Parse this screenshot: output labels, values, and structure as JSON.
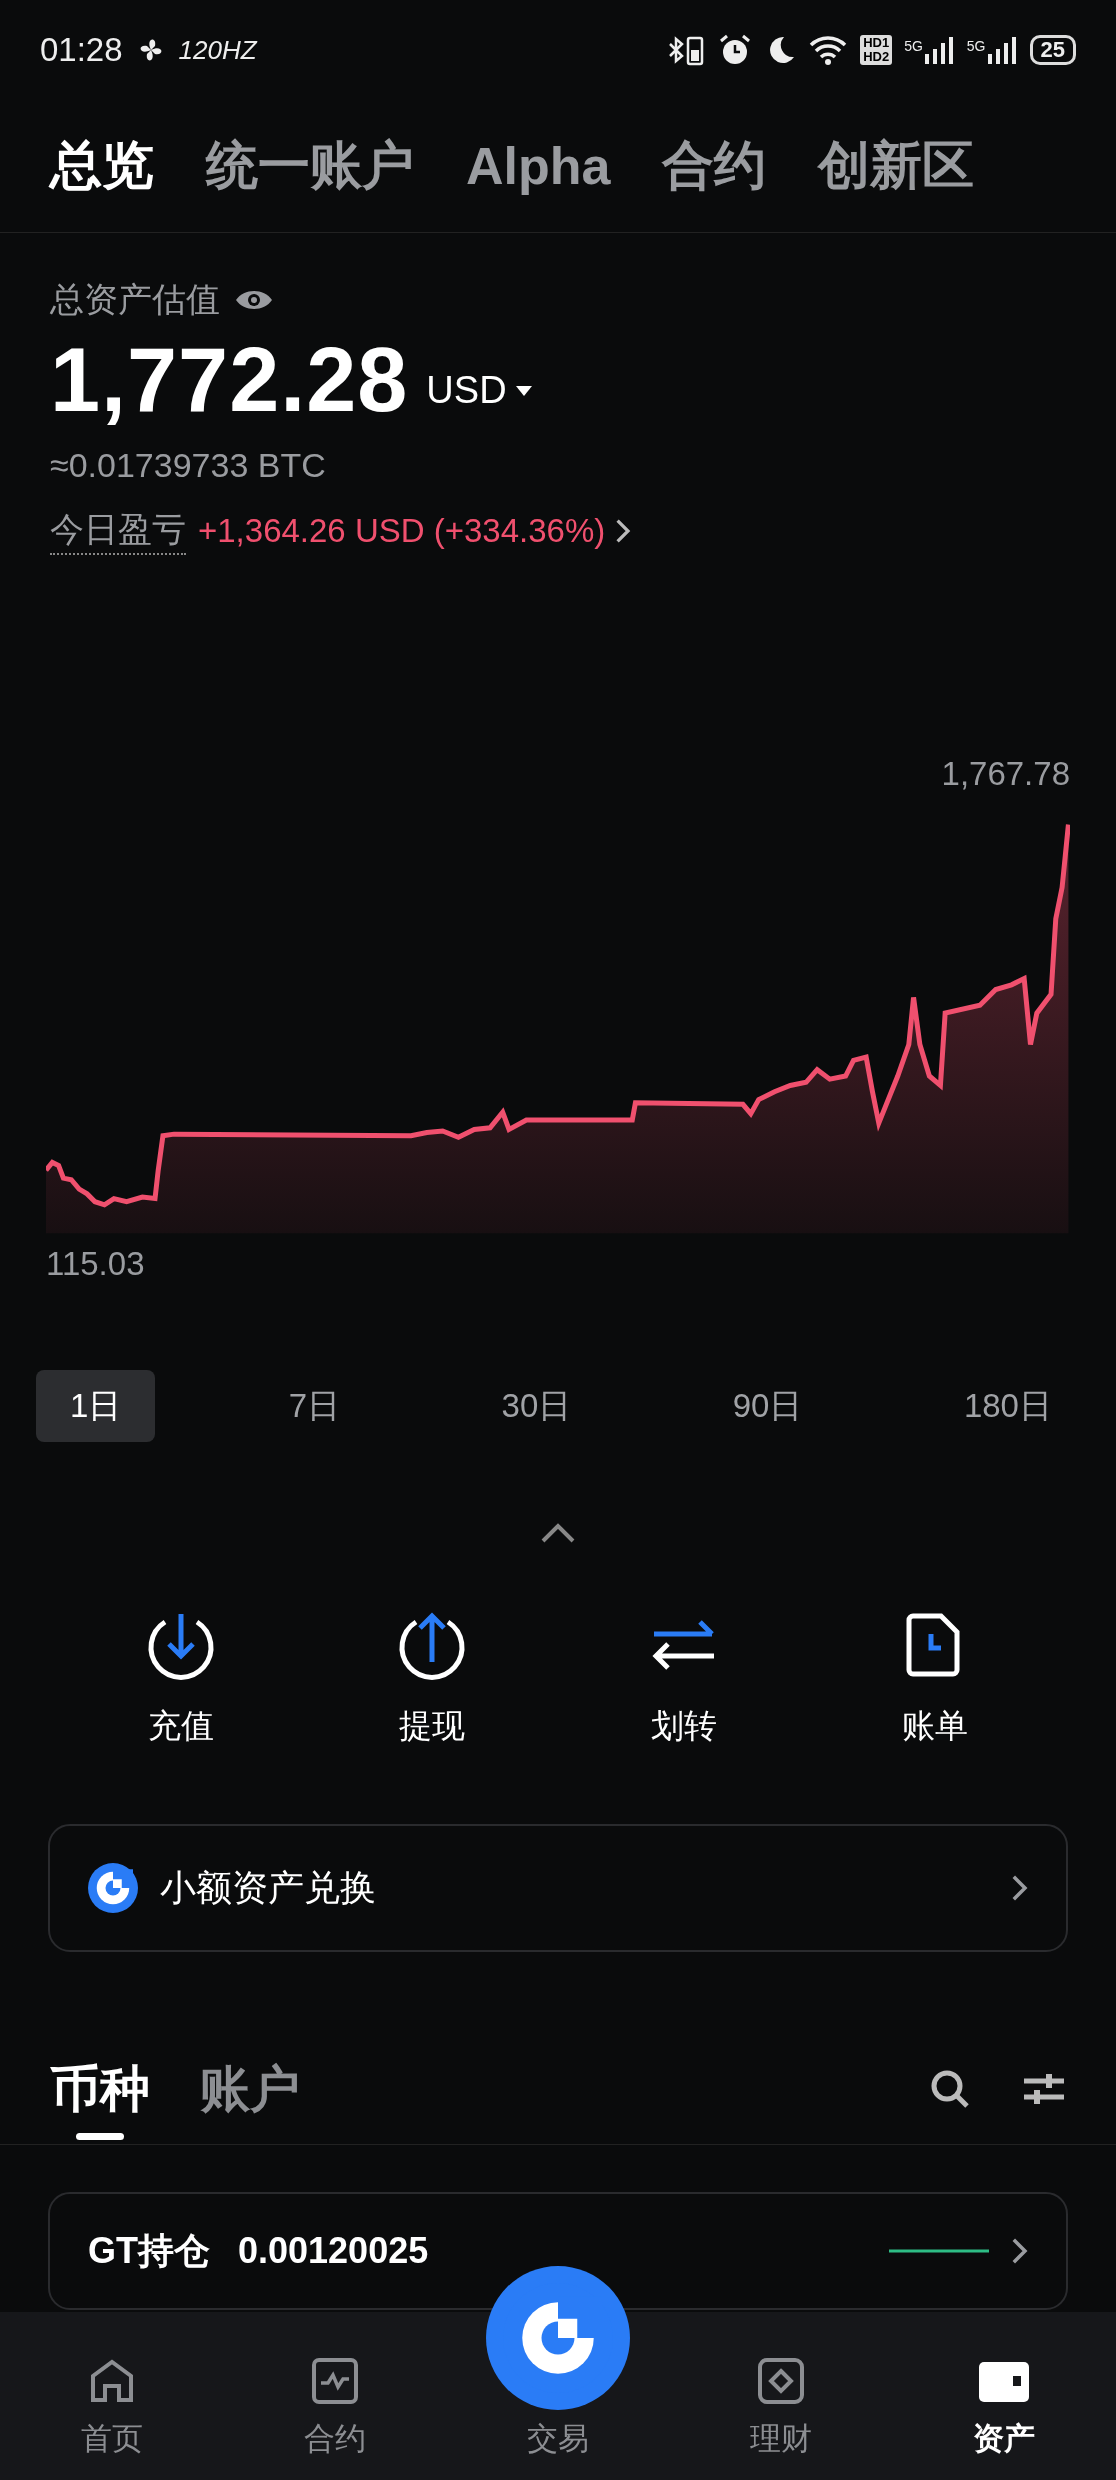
{
  "status_bar": {
    "time": "01:28",
    "refresh_rate": "120HZ",
    "hd_labels": [
      "HD1",
      "HD2"
    ],
    "signal_labels": [
      "5G",
      "5G"
    ],
    "battery": "25"
  },
  "top_tabs": [
    {
      "label": "总览",
      "selected": true
    },
    {
      "label": "统一账户",
      "selected": false
    },
    {
      "label": "Alpha",
      "selected": false
    },
    {
      "label": "合约",
      "selected": false
    },
    {
      "label": "创新区",
      "selected": false
    }
  ],
  "summary": {
    "title": "总资产估值",
    "amount": "1,772.28",
    "currency": "USD",
    "btc_value": "≈0.01739733 BTC",
    "pnl_label": "今日盈亏",
    "pnl_value": "+1,364.26 USD (+334.36%)"
  },
  "chart": {
    "max_label": "1,767.78",
    "min_label": "115.03"
  },
  "ranges": [
    {
      "label": "1日",
      "selected": true
    },
    {
      "label": "7日",
      "selected": false
    },
    {
      "label": "30日",
      "selected": false
    },
    {
      "label": "90日",
      "selected": false
    },
    {
      "label": "180日",
      "selected": false
    }
  ],
  "actions": [
    {
      "kind": "deposit",
      "label": "充值"
    },
    {
      "kind": "withdraw",
      "label": "提现"
    },
    {
      "kind": "transfer",
      "label": "划转"
    },
    {
      "kind": "bill",
      "label": "账单"
    }
  ],
  "convert_card": {
    "label": "小额资产兑换"
  },
  "asset_tabs": [
    {
      "label": "币种",
      "selected": true
    },
    {
      "label": "账户",
      "selected": false
    }
  ],
  "gt_card": {
    "label": "GT持仓",
    "value": "0.00120025"
  },
  "bottom_nav": [
    {
      "kind": "home",
      "label": "首页",
      "selected": false
    },
    {
      "kind": "futures",
      "label": "合约",
      "selected": false
    },
    {
      "kind": "trade",
      "label": "交易",
      "selected": false
    },
    {
      "kind": "earn",
      "label": "理财",
      "selected": false
    },
    {
      "kind": "assets",
      "label": "资产",
      "selected": true
    }
  ]
}
